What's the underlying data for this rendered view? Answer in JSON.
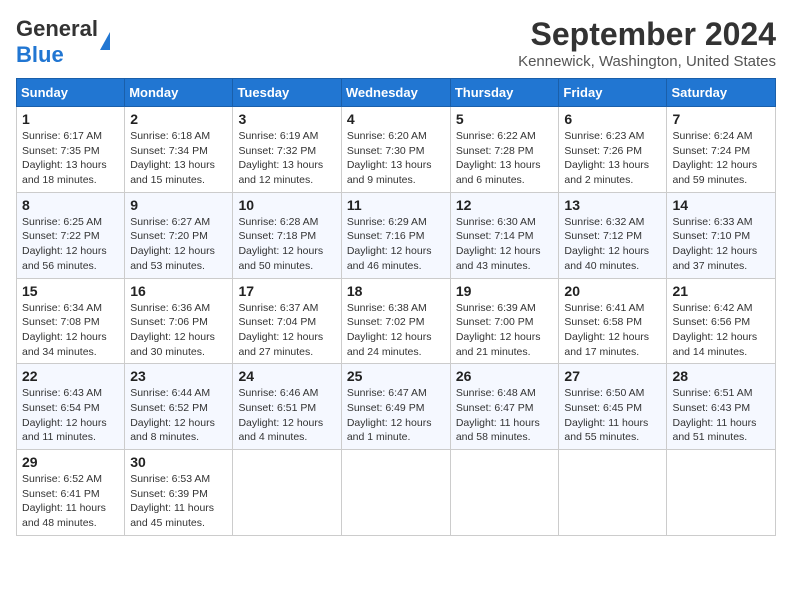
{
  "header": {
    "logo_general": "General",
    "logo_blue": "Blue",
    "month_title": "September 2024",
    "location": "Kennewick, Washington, United States"
  },
  "days_of_week": [
    "Sunday",
    "Monday",
    "Tuesday",
    "Wednesday",
    "Thursday",
    "Friday",
    "Saturday"
  ],
  "weeks": [
    [
      {
        "day": 1,
        "sunrise": "6:17 AM",
        "sunset": "7:35 PM",
        "daylight": "13 hours and 18 minutes."
      },
      {
        "day": 2,
        "sunrise": "6:18 AM",
        "sunset": "7:34 PM",
        "daylight": "13 hours and 15 minutes."
      },
      {
        "day": 3,
        "sunrise": "6:19 AM",
        "sunset": "7:32 PM",
        "daylight": "13 hours and 12 minutes."
      },
      {
        "day": 4,
        "sunrise": "6:20 AM",
        "sunset": "7:30 PM",
        "daylight": "13 hours and 9 minutes."
      },
      {
        "day": 5,
        "sunrise": "6:22 AM",
        "sunset": "7:28 PM",
        "daylight": "13 hours and 6 minutes."
      },
      {
        "day": 6,
        "sunrise": "6:23 AM",
        "sunset": "7:26 PM",
        "daylight": "13 hours and 2 minutes."
      },
      {
        "day": 7,
        "sunrise": "6:24 AM",
        "sunset": "7:24 PM",
        "daylight": "12 hours and 59 minutes."
      }
    ],
    [
      {
        "day": 8,
        "sunrise": "6:25 AM",
        "sunset": "7:22 PM",
        "daylight": "12 hours and 56 minutes."
      },
      {
        "day": 9,
        "sunrise": "6:27 AM",
        "sunset": "7:20 PM",
        "daylight": "12 hours and 53 minutes."
      },
      {
        "day": 10,
        "sunrise": "6:28 AM",
        "sunset": "7:18 PM",
        "daylight": "12 hours and 50 minutes."
      },
      {
        "day": 11,
        "sunrise": "6:29 AM",
        "sunset": "7:16 PM",
        "daylight": "12 hours and 46 minutes."
      },
      {
        "day": 12,
        "sunrise": "6:30 AM",
        "sunset": "7:14 PM",
        "daylight": "12 hours and 43 minutes."
      },
      {
        "day": 13,
        "sunrise": "6:32 AM",
        "sunset": "7:12 PM",
        "daylight": "12 hours and 40 minutes."
      },
      {
        "day": 14,
        "sunrise": "6:33 AM",
        "sunset": "7:10 PM",
        "daylight": "12 hours and 37 minutes."
      }
    ],
    [
      {
        "day": 15,
        "sunrise": "6:34 AM",
        "sunset": "7:08 PM",
        "daylight": "12 hours and 34 minutes."
      },
      {
        "day": 16,
        "sunrise": "6:36 AM",
        "sunset": "7:06 PM",
        "daylight": "12 hours and 30 minutes."
      },
      {
        "day": 17,
        "sunrise": "6:37 AM",
        "sunset": "7:04 PM",
        "daylight": "12 hours and 27 minutes."
      },
      {
        "day": 18,
        "sunrise": "6:38 AM",
        "sunset": "7:02 PM",
        "daylight": "12 hours and 24 minutes."
      },
      {
        "day": 19,
        "sunrise": "6:39 AM",
        "sunset": "7:00 PM",
        "daylight": "12 hours and 21 minutes."
      },
      {
        "day": 20,
        "sunrise": "6:41 AM",
        "sunset": "6:58 PM",
        "daylight": "12 hours and 17 minutes."
      },
      {
        "day": 21,
        "sunrise": "6:42 AM",
        "sunset": "6:56 PM",
        "daylight": "12 hours and 14 minutes."
      }
    ],
    [
      {
        "day": 22,
        "sunrise": "6:43 AM",
        "sunset": "6:54 PM",
        "daylight": "12 hours and 11 minutes."
      },
      {
        "day": 23,
        "sunrise": "6:44 AM",
        "sunset": "6:52 PM",
        "daylight": "12 hours and 8 minutes."
      },
      {
        "day": 24,
        "sunrise": "6:46 AM",
        "sunset": "6:51 PM",
        "daylight": "12 hours and 4 minutes."
      },
      {
        "day": 25,
        "sunrise": "6:47 AM",
        "sunset": "6:49 PM",
        "daylight": "12 hours and 1 minute."
      },
      {
        "day": 26,
        "sunrise": "6:48 AM",
        "sunset": "6:47 PM",
        "daylight": "11 hours and 58 minutes."
      },
      {
        "day": 27,
        "sunrise": "6:50 AM",
        "sunset": "6:45 PM",
        "daylight": "11 hours and 55 minutes."
      },
      {
        "day": 28,
        "sunrise": "6:51 AM",
        "sunset": "6:43 PM",
        "daylight": "11 hours and 51 minutes."
      }
    ],
    [
      {
        "day": 29,
        "sunrise": "6:52 AM",
        "sunset": "6:41 PM",
        "daylight": "11 hours and 48 minutes."
      },
      {
        "day": 30,
        "sunrise": "6:53 AM",
        "sunset": "6:39 PM",
        "daylight": "11 hours and 45 minutes."
      },
      null,
      null,
      null,
      null,
      null
    ]
  ]
}
